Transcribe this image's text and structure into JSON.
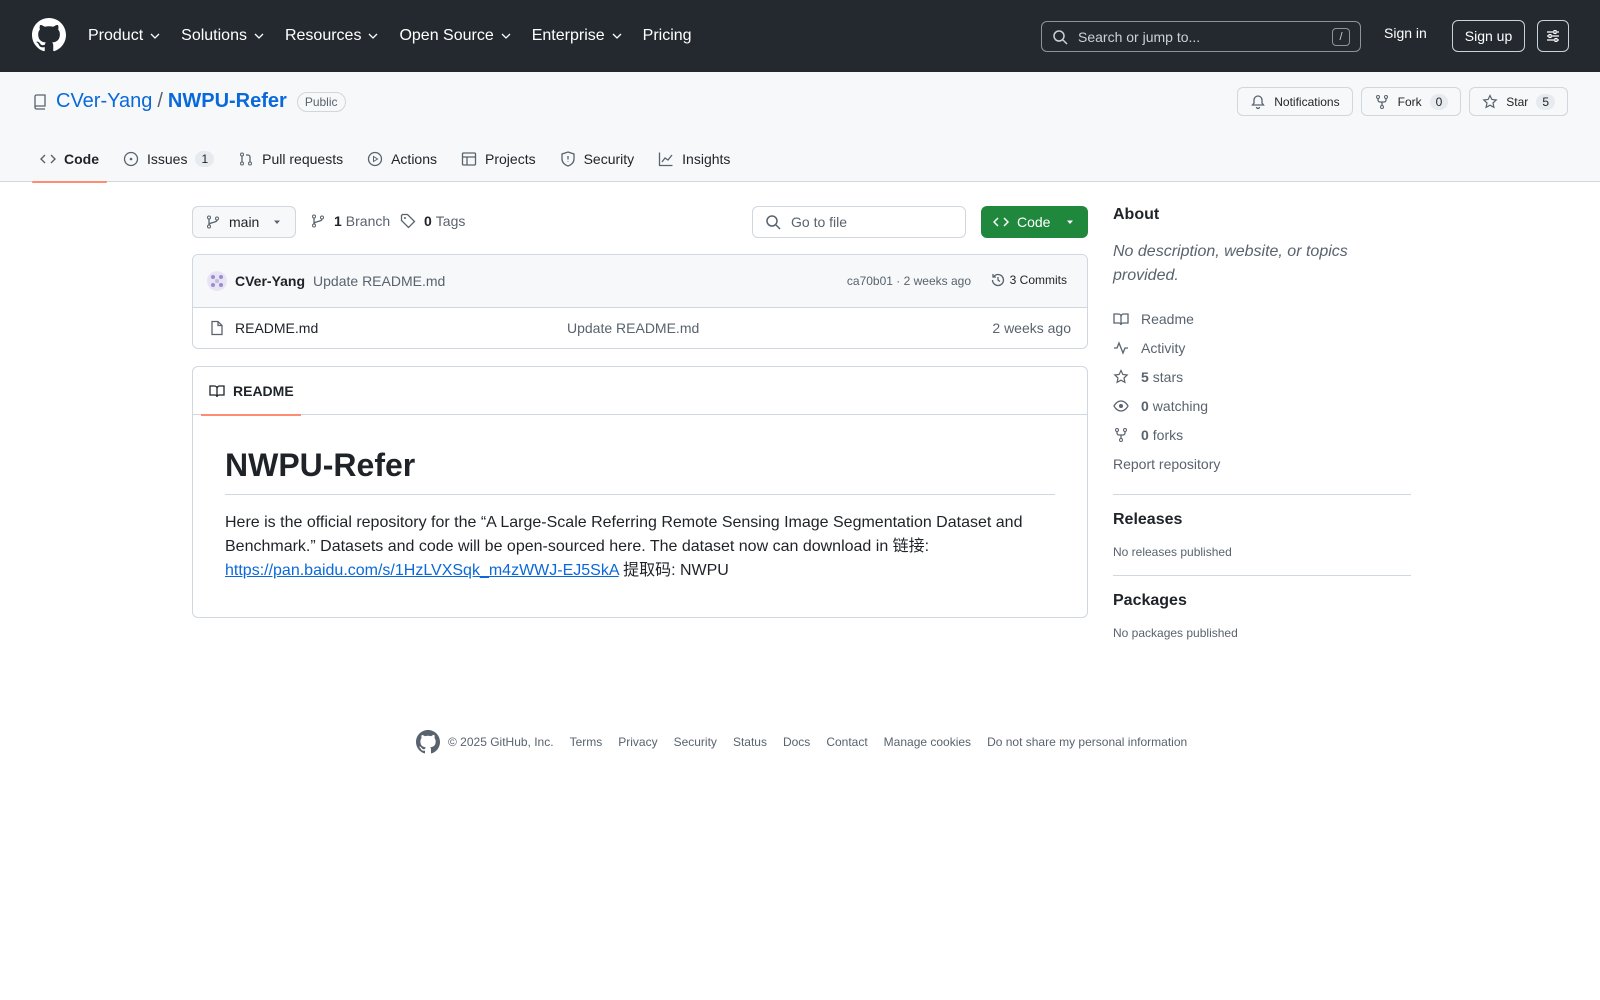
{
  "header": {
    "nav": [
      "Product",
      "Solutions",
      "Resources",
      "Open Source",
      "Enterprise",
      "Pricing"
    ],
    "search_placeholder": "Search or jump to...",
    "search_key": "/",
    "sign_in": "Sign in",
    "sign_up": "Sign up"
  },
  "repo": {
    "owner": "CVer-Yang",
    "separator": "/",
    "name": "NWPU-Refer",
    "visibility": "Public",
    "notifications_label": "Notifications",
    "fork_label": "Fork",
    "fork_count": "0",
    "star_label": "Star",
    "star_count": "5"
  },
  "tabs": [
    {
      "label": "Code",
      "active": true
    },
    {
      "label": "Issues",
      "counter": "1"
    },
    {
      "label": "Pull requests"
    },
    {
      "label": "Actions"
    },
    {
      "label": "Projects"
    },
    {
      "label": "Security"
    },
    {
      "label": "Insights"
    }
  ],
  "toolbar": {
    "branch": "main",
    "branch_count": "1",
    "branch_label": "Branch",
    "tag_count": "0",
    "tag_label": "Tags",
    "goto_placeholder": "Go to file",
    "code_label": "Code"
  },
  "commit": {
    "author": "CVer-Yang",
    "message": "Update README.md",
    "meta": "ca70b01 · 2 weeks ago",
    "commits_label": "3 Commits"
  },
  "files": [
    {
      "name": "README.md",
      "commit": "Update README.md",
      "age": "2 weeks ago"
    }
  ],
  "readme": {
    "tab_label": "README",
    "title": "NWPU-Refer",
    "text_before": "Here is the official repository for the “A Large-Scale Referring Remote Sensing Image Segmentation Dataset and Benchmark.” Datasets and code will be open-sourced here. The dataset now can download in 链接: ",
    "link": "https://pan.baidu.com/s/1HzLVXSqk_m4zWWJ-EJ5SkA",
    "text_after": " 提取码: NWPU"
  },
  "sidebar": {
    "about_title": "About",
    "about_desc": "No description, website, or topics provided.",
    "readme_label": "Readme",
    "activity_label": "Activity",
    "stars_count": "5",
    "stars_label": "stars",
    "watching_count": "0",
    "watching_label": "watching",
    "forks_count": "0",
    "forks_label": "forks",
    "report_label": "Report repository",
    "releases_title": "Releases",
    "releases_empty": "No releases published",
    "packages_title": "Packages",
    "packages_empty": "No packages published"
  },
  "footer": {
    "copyright": "© 2025 GitHub, Inc.",
    "links": [
      "Terms",
      "Privacy",
      "Security",
      "Status",
      "Docs",
      "Contact",
      "Manage cookies",
      "Do not share my personal information"
    ]
  },
  "colors": {
    "header_bg": "#24292f",
    "link": "#0969da",
    "primary_button": "#1f883d",
    "active_tab_underline": "#fd8c73"
  }
}
